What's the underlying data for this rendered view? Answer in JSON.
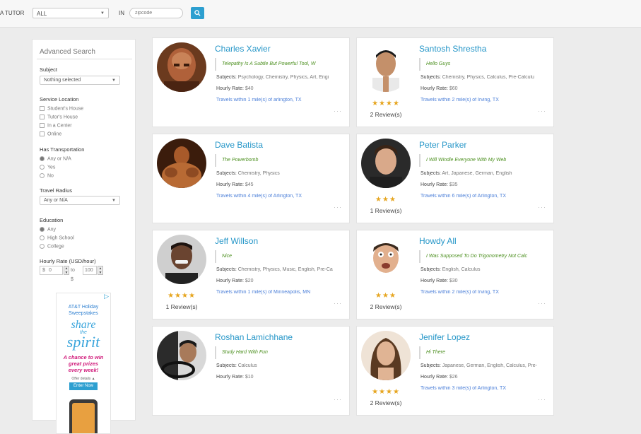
{
  "search": {
    "type_label": "A TUTOR",
    "type_value": "ALL",
    "in_label": "IN",
    "zip_placeholder": "zipcode"
  },
  "sidebar": {
    "title": "Advanced Search",
    "subject": {
      "label": "Subject",
      "value": "Nothing selected"
    },
    "service_location": {
      "label": "Service Location",
      "options": [
        "Student's House",
        "Tutor's House",
        "In a Center",
        "Online"
      ]
    },
    "transportation": {
      "label": "Has Transportation",
      "options": [
        "Any or N/A",
        "Yes",
        "No"
      ]
    },
    "travel_radius": {
      "label": "Travel Radius",
      "value": "Any or N/A"
    },
    "education": {
      "label": "Education",
      "options": [
        "Any",
        "High School",
        "College"
      ]
    },
    "hourly_rate": {
      "label": "Hourly Rate (USD/hour)",
      "currency": "$",
      "min": "0",
      "to": "to $",
      "max": "100"
    }
  },
  "ad": {
    "line1": "AT&T Holiday",
    "line2": "Sweepstakes",
    "share": "share",
    "the": "the",
    "spirit": "spirit",
    "chance1": "A chance to win",
    "chance2": "great prizes",
    "chance3": "every week!",
    "details": "Offer details ▲",
    "enter": "Enter Now"
  },
  "labels": {
    "subjects": "Subjects:",
    "rate": "Hourly Rate:"
  },
  "tutors": [
    {
      "name": "Charles Xavier",
      "motto": "Telepathy Is A Subtle But Powerful Tool, W",
      "subjects": "Psychology, Chemistry, Physics, Art, Engi",
      "rate": "$40",
      "travel": "Travels within 1 mile(s) of arlington, TX",
      "stars": "",
      "reviews": ""
    },
    {
      "name": "Santosh Shrestha",
      "motto": "Hello Guys",
      "subjects": "Chemistry, Physics, Calculus, Pre-Calculu",
      "rate": "$60",
      "travel": "Travels within 2 mile(s) of Irving, TX",
      "stars": "★★★★",
      "reviews": "2 Review(s)"
    },
    {
      "name": "Dave Batista",
      "motto": "The Powerbomb",
      "subjects": "Chemistry, Physics",
      "rate": "$45",
      "travel": "Travels within 4 mile(s) of Arlington, TX",
      "stars": "",
      "reviews": ""
    },
    {
      "name": "Peter Parker",
      "motto": "I Will Windle Everyone With My Web",
      "subjects": "Art, Japanese, German, English",
      "rate": "$35",
      "travel": "Travels within 6 mile(s) of Arlington, TX",
      "stars": "★★★",
      "reviews": "1 Review(s)"
    },
    {
      "name": "Jeff Willson",
      "motto": "Nice",
      "subjects": "Chemistry, Physics, Music, English, Pre-Ca",
      "rate": "$20",
      "travel": "Travels within 1 mile(s) of Minneapolis, MN",
      "stars": "★★★★",
      "reviews": "1 Review(s)"
    },
    {
      "name": "Howdy All",
      "motto": "I Was Supposed To Do Trigonometry Not Calc",
      "subjects": "English, Calculus",
      "rate": "$30",
      "travel": "Travels within 2 mile(s) of Irving, TX",
      "stars": "★★★",
      "reviews": "2 Review(s)"
    },
    {
      "name": "Roshan Lamichhane",
      "motto": "Study Hard With Fun",
      "subjects": "Calculus",
      "rate": "$10",
      "travel": "",
      "stars": "",
      "reviews": ""
    },
    {
      "name": "Jenifer Lopez",
      "motto": "Hi There",
      "subjects": "Japanese, German, English, Calculus, Pre-",
      "rate": "$26",
      "travel": "Travels within 3 mile(s) of Arlington, TX",
      "stars": "★★★★",
      "reviews": "2 Review(s)"
    }
  ],
  "more_glyph": "···",
  "colors": {
    "accent": "#2596c8",
    "motto": "#4b8f1e",
    "link": "#4a7ed8",
    "stars": "#e6a51f",
    "button": "#2d9fd0"
  }
}
